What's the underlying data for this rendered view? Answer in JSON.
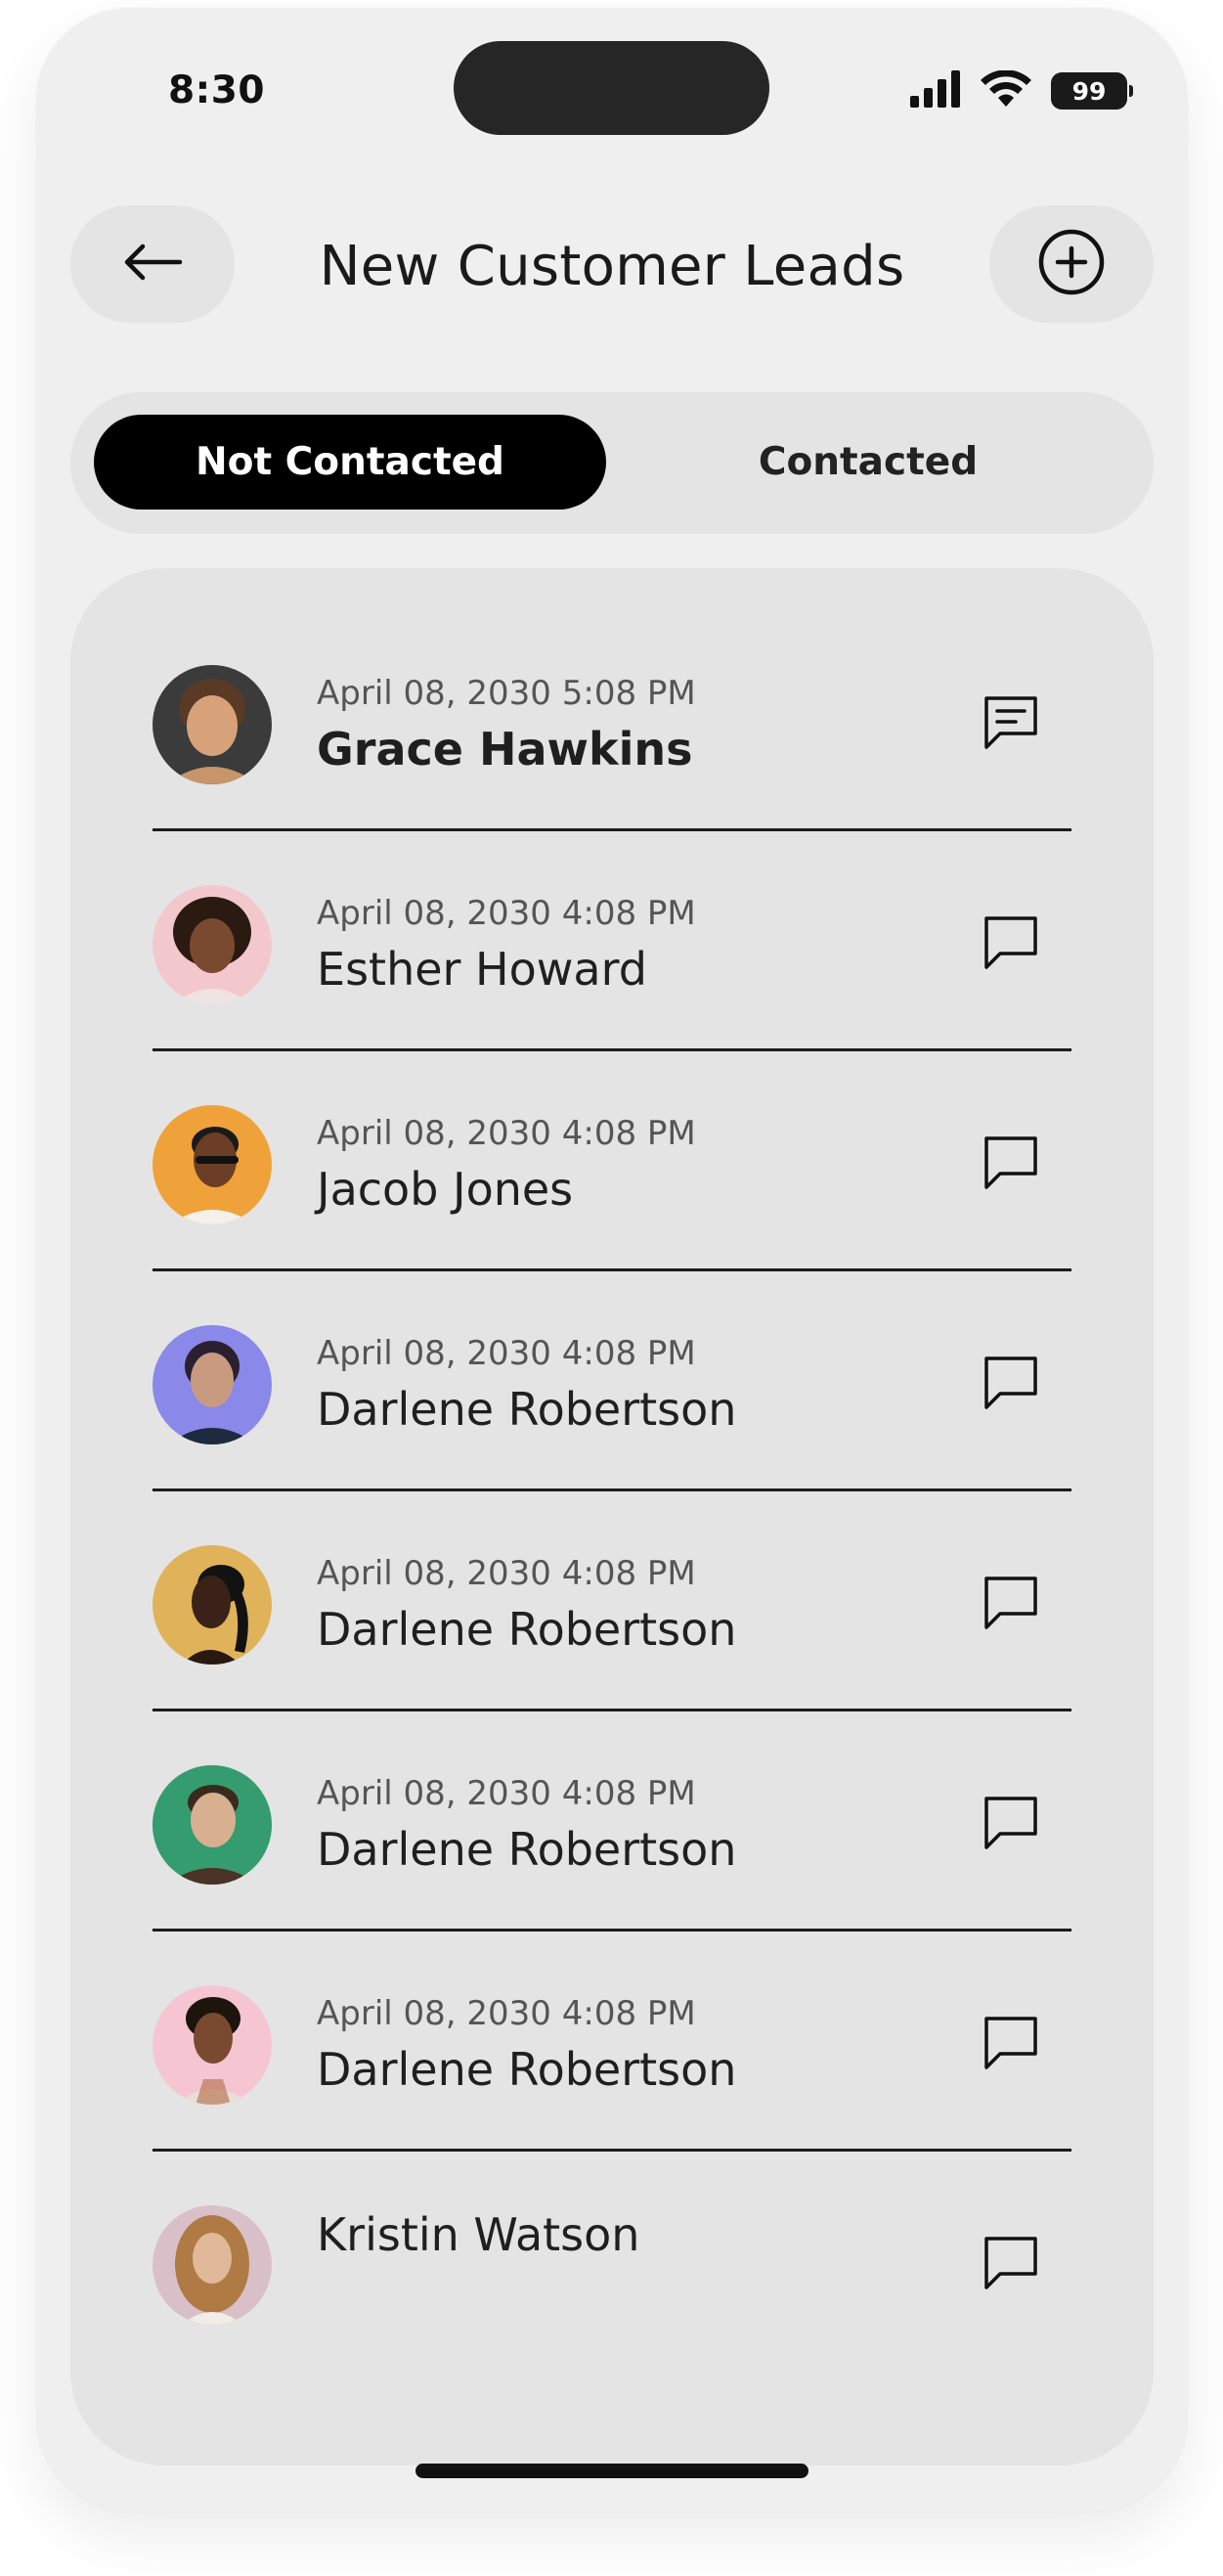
{
  "status_bar": {
    "time": "8:30",
    "battery": "99"
  },
  "header": {
    "title": "New Customer Leads"
  },
  "tabs": [
    {
      "label": "Not Contacted",
      "active": true
    },
    {
      "label": "Contacted",
      "active": false
    }
  ],
  "leads": [
    {
      "date": "April 08, 2030 5:08 PM",
      "name": "Grace Hawkins",
      "unread": true,
      "avatar_bg": "#3b3b3b",
      "avatar_skin": "#d7a27a",
      "avatar_hair": "#5a3a24"
    },
    {
      "date": "April 08, 2030 4:08 PM",
      "name": "Esther Howard",
      "unread": false,
      "avatar_bg": "#f3c8cc",
      "avatar_skin": "#7a4a30",
      "avatar_hair": "#2a1a12"
    },
    {
      "date": "April 08, 2030 4:08 PM",
      "name": "Jacob Jones",
      "unread": false,
      "avatar_bg": "#f0a23a",
      "avatar_skin": "#6b3e25",
      "avatar_hair": "#1a1a1a"
    },
    {
      "date": "April 08, 2030 4:08 PM",
      "name": "Darlene Robertson",
      "unread": false,
      "avatar_bg": "#8a88e8",
      "avatar_skin": "#c89a80",
      "avatar_hair": "#2a2030"
    },
    {
      "date": "April 08, 2030 4:08 PM",
      "name": "Darlene Robertson",
      "unread": false,
      "avatar_bg": "#e0b35a",
      "avatar_skin": "#3a2218",
      "avatar_hair": "#121212"
    },
    {
      "date": "April 08, 2030 4:08 PM",
      "name": "Darlene Robertson",
      "unread": false,
      "avatar_bg": "#3fae7a",
      "avatar_skin": "#d8b090",
      "avatar_hair": "#3a2a1e"
    },
    {
      "date": "April 08, 2030 4:08 PM",
      "name": "Darlene Robertson",
      "unread": false,
      "avatar_bg": "#f5c6d2",
      "avatar_skin": "#7a4a30",
      "avatar_hair": "#1e140e"
    },
    {
      "date": "",
      "name": "Kristin Watson",
      "unread": false,
      "avatar_bg": "#d9c0c8",
      "avatar_skin": "#e0b89a",
      "avatar_hair": "#b07a44"
    }
  ],
  "icons": {
    "back": "arrow-left-icon",
    "add": "plus-circle-icon",
    "message_unread": "message-lines-icon",
    "message": "message-icon",
    "signal": "signal-icon",
    "wifi": "wifi-icon"
  }
}
